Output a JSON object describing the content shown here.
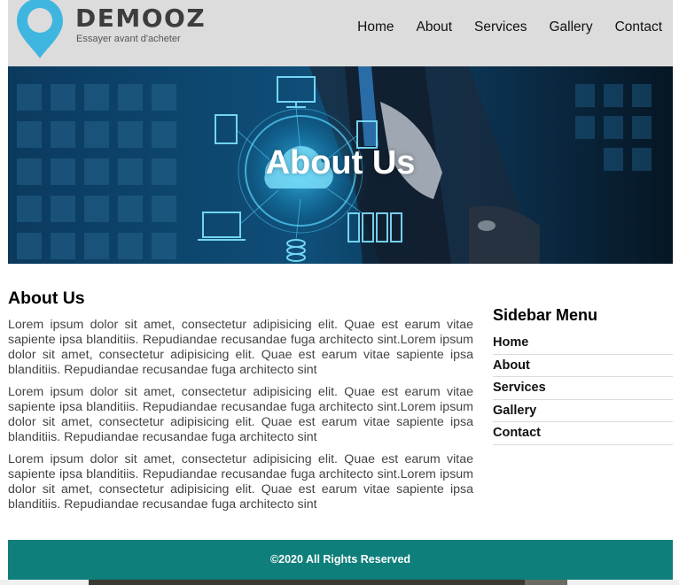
{
  "header": {
    "brand_name": "DEMOOZ",
    "brand_tagline": "Essayer avant d'acheter",
    "nav": [
      "Home",
      "About",
      "Services",
      "Gallery",
      "Contact"
    ]
  },
  "banner": {
    "title": "About Us"
  },
  "main": {
    "title": "About Us",
    "paragraphs": [
      "Lorem ipsum dolor sit amet, consectetur adipisicing elit. Quae est earum vitae sapiente ipsa blanditiis. Repudiandae recusandae fuga architecto sint.Lorem ipsum dolor sit amet, consectetur adipisicing elit. Quae est earum vitae sapiente ipsa blanditiis. Repudiandae recusandae fuga architecto sint",
      "Lorem ipsum dolor sit amet, consectetur adipisicing elit. Quae est earum vitae sapiente ipsa blanditiis. Repudiandae recusandae fuga architecto sint.Lorem ipsum dolor sit amet, consectetur adipisicing elit. Quae est earum vitae sapiente ipsa blanditiis. Repudiandae recusandae fuga architecto sint",
      "Lorem ipsum dolor sit amet, consectetur adipisicing elit. Quae est earum vitae sapiente ipsa blanditiis. Repudiandae recusandae fuga architecto sint.Lorem ipsum dolor sit amet, consectetur adipisicing elit. Quae est earum vitae sapiente ipsa blanditiis. Repudiandae recusandae fuga architecto sint"
    ]
  },
  "sidebar": {
    "title": "Sidebar Menu",
    "items": [
      "Home",
      "About",
      "Services",
      "Gallery",
      "Contact"
    ]
  },
  "footer": {
    "text": "©2020 All Rights Reserved"
  },
  "colors": {
    "header_bg": "#dcdcdc",
    "logo_pin": "#3fb6e0",
    "footer_bg": "#0e7f7a"
  },
  "icons": {
    "logo": "location-pin-icon"
  }
}
